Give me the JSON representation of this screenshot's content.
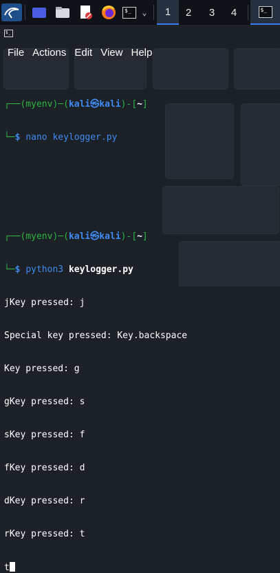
{
  "panel": {
    "workspaces": [
      "1",
      "2",
      "3",
      "4"
    ],
    "active_workspace": "1",
    "accent": "#367bf0"
  },
  "menu": {
    "items": [
      "File",
      "Actions",
      "Edit",
      "View",
      "Help"
    ]
  },
  "terminal": {
    "prompt1": {
      "venv": "(myenv)",
      "user": "kali",
      "at": "㉿",
      "host": "kali",
      "dir": "~",
      "command": "nano keylogger.py"
    },
    "prompt2": {
      "venv": "(myenv)",
      "user": "kali",
      "at": "㉿",
      "host": "kali",
      "dir": "~",
      "cmd_name": "python3",
      "cmd_arg": "keylogger.py"
    },
    "output": [
      "jKey pressed: j",
      "Special key pressed: Key.backspace",
      "Key pressed: g",
      "gKey pressed: s",
      "sKey pressed: f",
      "fKey pressed: d",
      "dKey pressed: r",
      "rKey pressed: t"
    ],
    "current_input": "t"
  },
  "colors": {
    "background": "#1c2027",
    "prompt_green": "#2fb544",
    "prompt_blue": "#3f8af0"
  }
}
